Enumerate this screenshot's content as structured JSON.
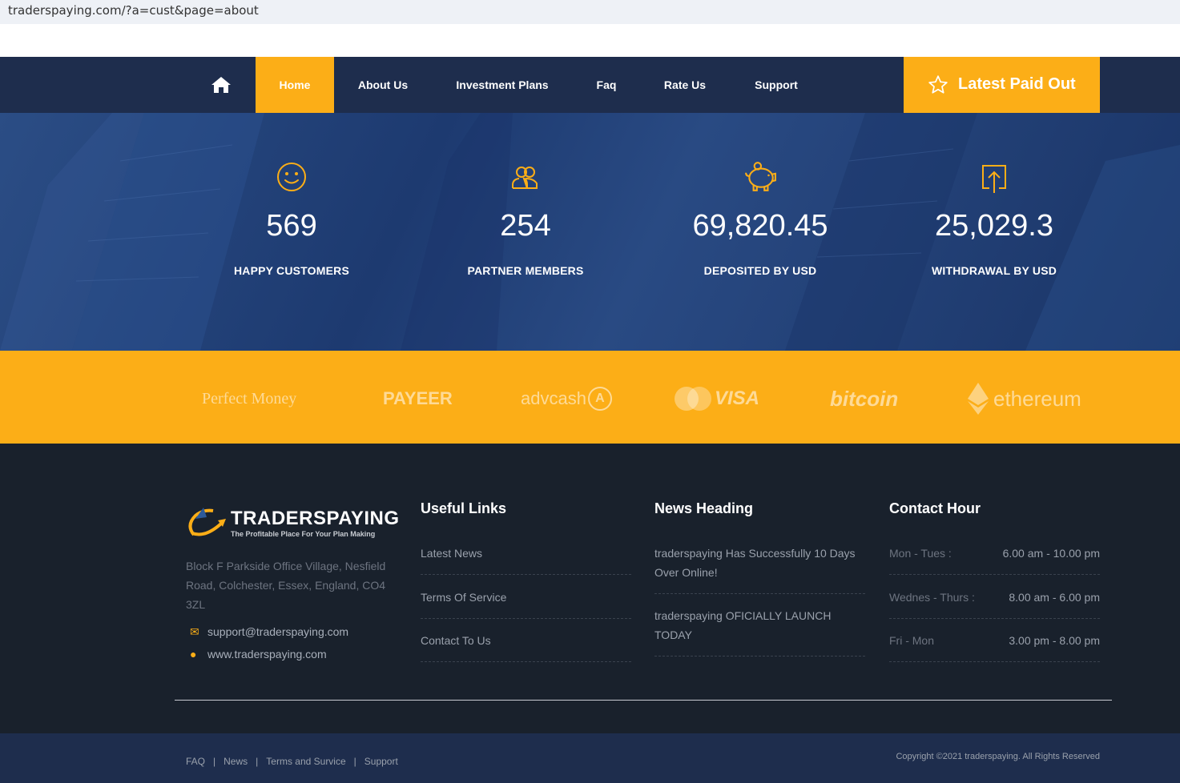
{
  "browser": {
    "url": "traderspaying.com/?a=cust&page=about"
  },
  "nav": {
    "items": [
      "Home",
      "About Us",
      "Investment Plans",
      "Faq",
      "Rate Us",
      "Support"
    ],
    "latest_paid": "Latest Paid Out"
  },
  "stats": [
    {
      "value": "569",
      "label": "HAPPY CUSTOMERS",
      "icon": "smiley-icon"
    },
    {
      "value": "254",
      "label": "PARTNER MEMBERS",
      "icon": "users-icon"
    },
    {
      "value": "69,820.45",
      "label": "DEPOSITED BY USD",
      "icon": "piggy-bank-icon"
    },
    {
      "value": "25,029.3",
      "label": "WITHDRAWAL BY USD",
      "icon": "upload-icon"
    }
  ],
  "payments": [
    "Perfect Money",
    "PAYEER",
    "advcash",
    "MasterCard VISA",
    "bitcoin",
    "ethereum"
  ],
  "footer": {
    "logo_title": "TRADERSPAYING",
    "logo_tagline": "The Profitable Place For Your Plan Making",
    "address": "Block F Parkside Office Village, Nesfield Road, Colchester, Essex, England, CO4 3ZL",
    "email": "support@traderspaying.com",
    "website": "www.traderspaying.com",
    "useful_links": {
      "title": "Useful Links",
      "items": [
        "Latest News",
        "Terms Of Service",
        "Contact To Us"
      ]
    },
    "news": {
      "title": "News Heading",
      "items": [
        "traderspaying Has Successfully 10 Days Over Online!",
        "traderspaying OFICIALLY LAUNCH TODAY"
      ]
    },
    "contact_hour": {
      "title": "Contact Hour",
      "rows": [
        {
          "day": "Mon - Tues :",
          "time": "6.00 am - 10.00 pm"
        },
        {
          "day": "Wednes - Thurs :",
          "time": "8.00 am - 6.00 pm"
        },
        {
          "day": "Fri - Mon",
          "time": "3.00 pm - 8.00 pm"
        }
      ]
    }
  },
  "bottom": {
    "links": [
      "FAQ",
      "News",
      "Terms and Survice",
      "Support"
    ],
    "copyright": "Copyright ©2021 traderspaying. All Rights Reserved"
  },
  "colors": {
    "accent": "#fcae17",
    "nav_bg": "#1e2d4d",
    "footer_bg": "#19212c"
  }
}
